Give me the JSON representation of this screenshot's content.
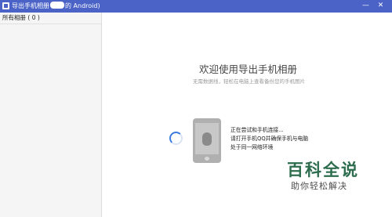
{
  "window": {
    "title_prefix": "导出手机相册",
    "title_suffix": "的 Android)",
    "minimize_glyph": "—",
    "close_glyph": "✕"
  },
  "sidebar": {
    "header": "所有相册 ( 0 )"
  },
  "main": {
    "title": "欢迎使用导出手机相册",
    "subtitle": "无需数据线，轻松在电脑上查看备份您的手机图片",
    "status_lines": [
      "正在尝试和手机连接...",
      "请打开手机QQ并确保手机与电脑",
      "处于同一网络环境"
    ]
  },
  "watermark": {
    "main": "百科全说",
    "sub": "助你轻松解决"
  },
  "icons": {
    "app": "app-icon",
    "phone": "phone-icon",
    "qq": "qq-penguin-icon",
    "loading": "loading-spinner-icon"
  },
  "colors": {
    "titlebar": "#4b63c7",
    "spinner": "#3d7be0",
    "watermark": "#2d6d4e"
  }
}
